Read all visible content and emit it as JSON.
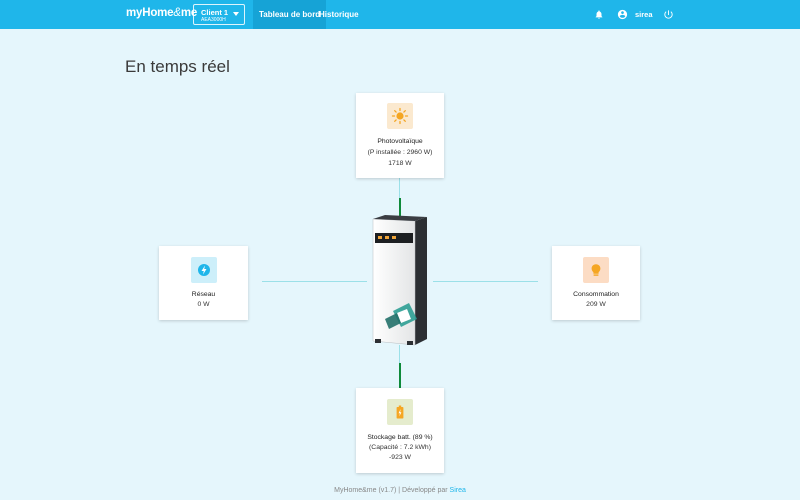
{
  "header": {
    "logo_main": "myHome",
    "logo_rest": "me",
    "client_name": "Client 1",
    "client_code": "AEA3000H",
    "tabs": [
      {
        "label": "Tableau de bord",
        "active": true
      },
      {
        "label": "Historique",
        "active": false
      }
    ],
    "user_name": "sirea",
    "icons": [
      "bell-icon",
      "account-icon",
      "power-icon"
    ]
  },
  "page": {
    "title": "En temps réel"
  },
  "cards": {
    "solar": {
      "title": "Photovoltaïque",
      "sub": "(P installée : 2960 W)",
      "value": "1718 W",
      "icon": "sun-icon",
      "icon_bg": "#fbe9cf",
      "icon_color": "#f4a623"
    },
    "grid": {
      "title": "Réseau",
      "value": "0 W",
      "icon": "lightning-icon",
      "icon_bg": "#cdeffa",
      "icon_color": "#1fb6ea"
    },
    "consumption": {
      "title": "Consommation",
      "value": "209 W",
      "icon": "bulb-icon",
      "icon_bg": "#fcdcc4",
      "icon_color": "#f5a623"
    },
    "battery": {
      "title": "Stockage batt. (89 %)",
      "sub": "(Capacité : 7.2 kWh)",
      "value": "-923 W",
      "icon": "battery-icon",
      "icon_bg": "#e5eccd",
      "icon_color": "#f5a623"
    }
  },
  "colors": {
    "topbar": "#1fb6ea",
    "background": "#e5f6fc",
    "active_flow": "#0f8a3a",
    "idle_flow": "#9be0e8"
  },
  "footer": {
    "text": "MyHome&me (v1.7) | Développé par ",
    "link": "Sirea"
  }
}
